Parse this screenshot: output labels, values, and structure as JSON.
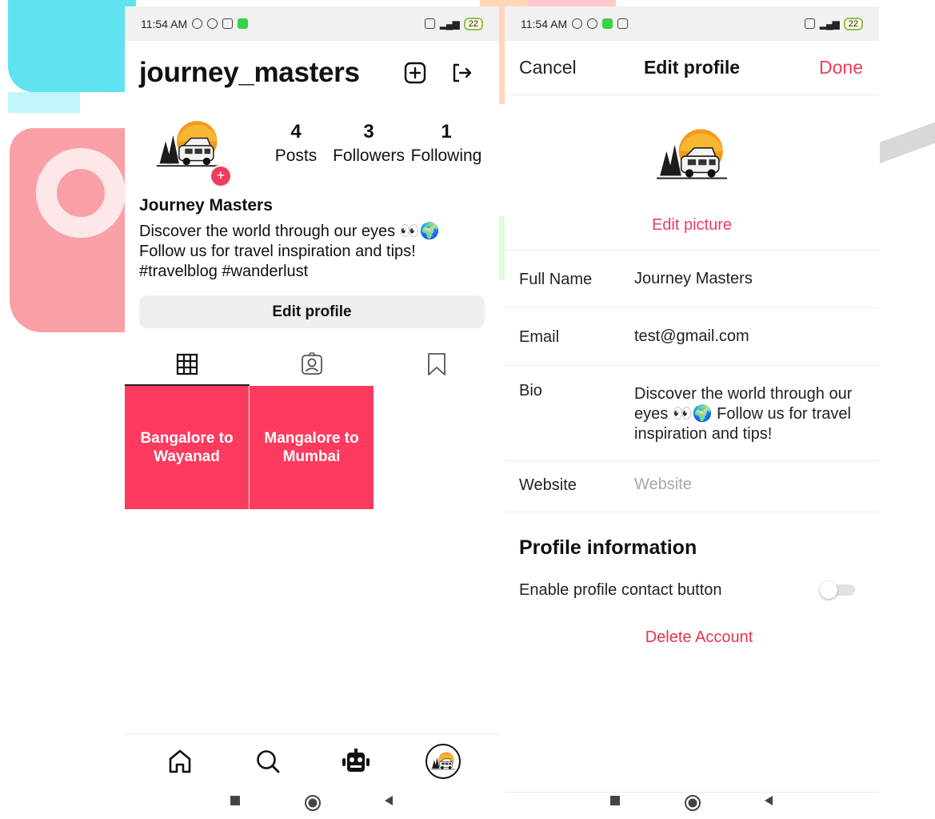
{
  "colors": {
    "accent": "#ef3b5e",
    "post_tile": "#fe3a5e",
    "delete": "#e8344f",
    "placeholder": "#a8a8a8"
  },
  "status_bar": {
    "time": "11:54 AM",
    "battery": "22"
  },
  "profile_screen": {
    "username": "journey_masters",
    "header_icons": [
      "add-post-icon",
      "logout-icon"
    ],
    "stats": [
      {
        "value": "4",
        "label": "Posts"
      },
      {
        "value": "3",
        "label": "Followers"
      },
      {
        "value": "1",
        "label": "Following"
      }
    ],
    "display_name": "Journey Masters",
    "bio_lines": [
      "Discover the world through our eyes 👀🌍",
      "Follow us for travel inspiration and tips!",
      "#travelblog #wanderlust"
    ],
    "edit_profile_label": "Edit profile",
    "tabs": [
      "grid-icon",
      "tagged-icon",
      "saved-icon"
    ],
    "posts": [
      {
        "title": "Bangalore to Wayanad"
      },
      {
        "title": "Mangalore to Mumbai"
      }
    ],
    "bottom_nav": [
      "home-icon",
      "search-icon",
      "bot-icon",
      "profile-avatar"
    ]
  },
  "edit_screen": {
    "cancel_label": "Cancel",
    "title": "Edit profile",
    "done_label": "Done",
    "edit_picture_label": "Edit picture",
    "fields": {
      "full_name": {
        "label": "Full Name",
        "value": "Journey Masters"
      },
      "email": {
        "label": "Email",
        "value": "test@gmail.com"
      },
      "bio": {
        "label": "Bio",
        "value": "Discover the world through our eyes 👀🌍 Follow us for travel inspiration and tips!"
      },
      "website": {
        "label": "Website",
        "value": "",
        "placeholder": "Website"
      }
    },
    "section_title": "Profile information",
    "contact_toggle_label": "Enable profile contact button",
    "contact_toggle_on": false,
    "delete_label": "Delete Account"
  }
}
